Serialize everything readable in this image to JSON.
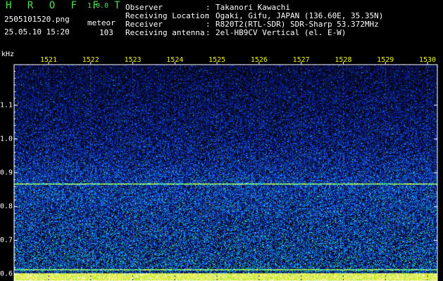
{
  "app": {
    "logo": "H R O F F T",
    "version": "1.0.0"
  },
  "file": {
    "name": "2505101520.png",
    "category": "meteor",
    "timestamp": "25.05.10 15:20",
    "count": "103"
  },
  "info": [
    {
      "key": "Observer",
      "value": "Takanori Kawachi"
    },
    {
      "key": "Receiving Location",
      "value": "Ogaki, Gifu, JAPAN (136.60E, 35.35N)"
    },
    {
      "key": "Receiver",
      "value": "R820T2(RTL-SDR) SDR-Sharp 53.372MHz"
    },
    {
      "key": "Receiving antenna",
      "value": "2el-HB9CV Vertical (el. E-W)"
    }
  ],
  "chart_data": {
    "type": "heatmap",
    "ylabel": "kHz",
    "x_ticks": [
      "1521",
      "1522",
      "1523",
      "1524",
      "1525",
      "1526",
      "1527",
      "1528",
      "1529",
      "1530"
    ],
    "y_ticks": [
      "1.1",
      "1.0",
      "0.9",
      "0.8",
      "0.7",
      "0.6"
    ],
    "ylim": [
      0.58,
      1.22
    ],
    "grid": true,
    "colormap": [
      "#000000",
      "#08104a",
      "#0a2cc8",
      "#1a6cff",
      "#18c0e8",
      "#40e070",
      "#e8e820",
      "#ffffff"
    ],
    "features": [
      {
        "label": "carrier line",
        "y_khz": 0.867
      },
      {
        "label": "carrier line",
        "y_khz": 0.615
      },
      {
        "label": "carrier line",
        "y_khz": 0.595
      }
    ]
  }
}
